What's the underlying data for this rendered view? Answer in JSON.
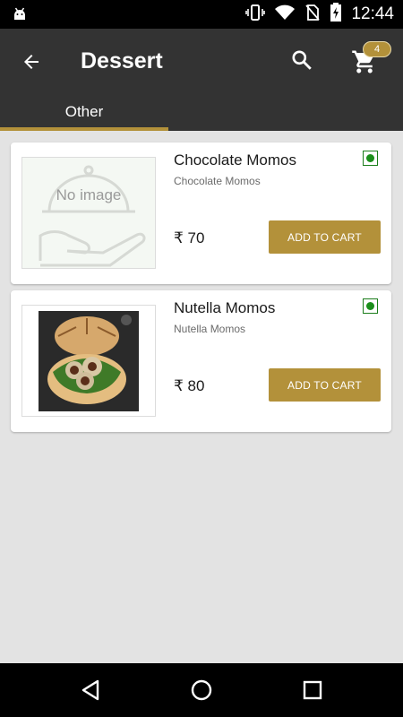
{
  "status_bar": {
    "time": "12:44",
    "icons": [
      "android-icon",
      "vibrate-icon",
      "wifi-icon",
      "no-sim-icon",
      "battery-charging-icon"
    ]
  },
  "app_bar": {
    "title": "Dessert",
    "cart_count": "4",
    "icons": [
      "back-arrow-icon",
      "search-icon",
      "cart-icon"
    ]
  },
  "tabs": [
    {
      "label": "Other",
      "selected": true
    }
  ],
  "colors": {
    "accent": "#b3913a",
    "app_bar": "#333333",
    "veg": "#1b8f1b",
    "background": "#e3e3e3"
  },
  "items": [
    {
      "name": "Chocolate Momos",
      "description": "Chocolate Momos",
      "price": "₹ 70",
      "button": "ADD TO CART",
      "image_placeholder": "No image"
    },
    {
      "name": "Nutella Momos",
      "description": "Nutella Momos",
      "price": "₹ 80",
      "button": "ADD TO CART"
    }
  ],
  "nav_bar": {
    "icons": [
      "back-triangle-icon",
      "home-circle-icon",
      "recents-square-icon"
    ]
  }
}
